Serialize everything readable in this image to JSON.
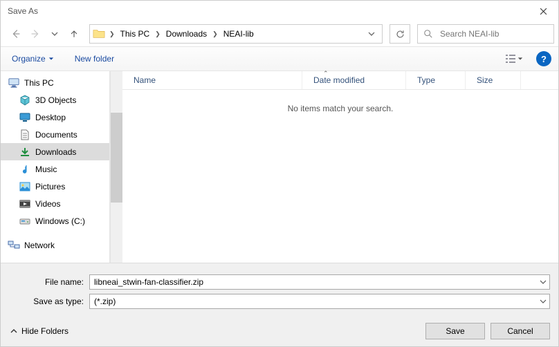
{
  "title": "Save As",
  "nav": {
    "breadcrumb": [
      "This PC",
      "Downloads",
      "NEAI-lib"
    ],
    "search_placeholder": "Search NEAI-lib"
  },
  "toolbar": {
    "organize": "Organize",
    "newfolder": "New folder"
  },
  "tree": {
    "root": "This PC",
    "items": [
      {
        "label": "3D Objects",
        "icon": "3dobjects"
      },
      {
        "label": "Desktop",
        "icon": "desktop"
      },
      {
        "label": "Documents",
        "icon": "documents"
      },
      {
        "label": "Downloads",
        "icon": "downloads",
        "selected": true
      },
      {
        "label": "Music",
        "icon": "music"
      },
      {
        "label": "Pictures",
        "icon": "pictures"
      },
      {
        "label": "Videos",
        "icon": "videos"
      },
      {
        "label": "Windows (C:)",
        "icon": "drive"
      }
    ],
    "network": "Network"
  },
  "columns": {
    "name": "Name",
    "date": "Date modified",
    "type": "Type",
    "size": "Size"
  },
  "filelist": {
    "empty": "No items match your search."
  },
  "form": {
    "filename_label": "File name:",
    "filename_value": "libneai_stwin-fan-classifier.zip",
    "savetype_label": "Save as type:",
    "savetype_value": " (*.zip)"
  },
  "actions": {
    "hide_folders": "Hide Folders",
    "save": "Save",
    "cancel": "Cancel"
  }
}
